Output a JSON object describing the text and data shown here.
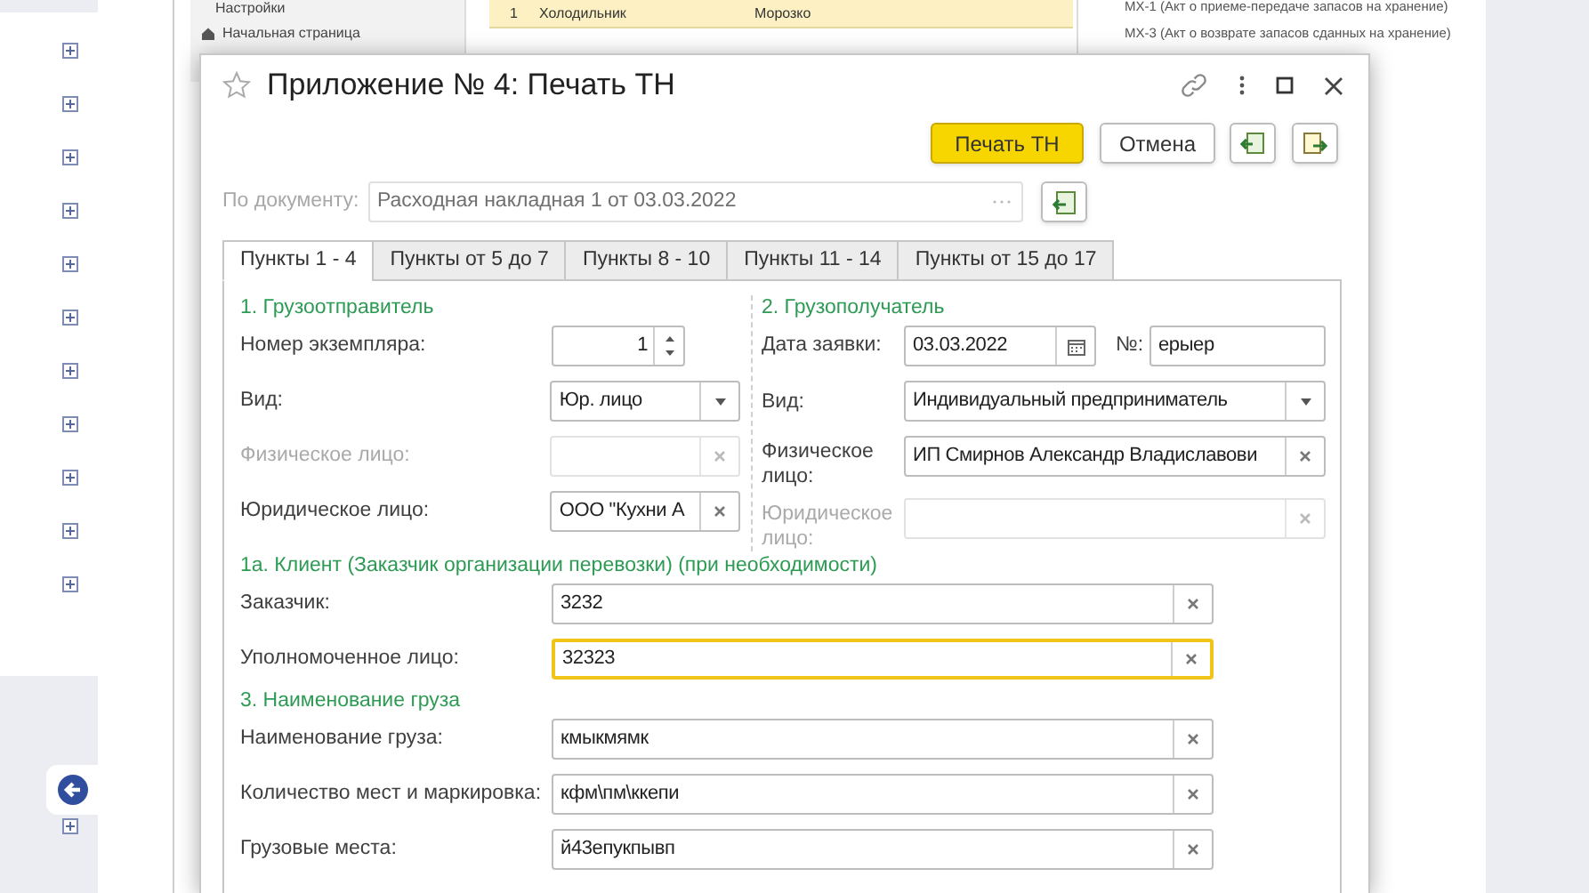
{
  "background": {
    "nav_items": [
      "Настройки",
      "Начальная страница"
    ],
    "table_row": {
      "number": "1",
      "name": "Холодильник",
      "supplier": "Морозко"
    },
    "print_forms": [
      "МХ-1 (Акт о приеме-передаче запасов на хранение)",
      "МХ-3 (Акт о возврате запасов сданных на хранение)"
    ]
  },
  "dialog": {
    "title": "Приложение № 4: Печать ТН",
    "buttons": [
      {
        "label": "Печать ТН",
        "kind": "default"
      },
      {
        "label": "Отмена",
        "kind": "normal"
      }
    ],
    "document": {
      "label": "По документу:",
      "value": "Расходная накладная 1 от 03.03.2022",
      "disabled": true
    },
    "tabs": [
      {
        "label": "Пункты 1 - 4",
        "selected": true
      },
      {
        "label": "Пункты от 5 до 7",
        "selected": false
      },
      {
        "label": "Пункты 8 - 10",
        "selected": false
      },
      {
        "label": "Пункты 11 - 14",
        "selected": false
      },
      {
        "label": "Пункты от 15 до 17",
        "selected": false
      }
    ],
    "shipper": {
      "heading": "1. Грузоотправитель",
      "fields": [
        {
          "label": "Номер экземпляра:",
          "value": "1",
          "kind": "spin",
          "disabled": false
        },
        {
          "label": "Вид:",
          "value": "Юр. лицо",
          "kind": "select",
          "disabled": false
        },
        {
          "label": "Физическое лицо:",
          "kind": "clear",
          "disabled": true
        },
        {
          "label": "Юридическое лицо:",
          "value": "ООО \"Кухни А",
          "kind": "clear",
          "disabled": false
        }
      ]
    },
    "consignee": {
      "heading": "2. Грузополучатель",
      "request_date": {
        "label": "Дата заявки:",
        "value": "03.03.2022"
      },
      "number": {
        "label": "№:",
        "value": "ерыер"
      },
      "fields": [
        {
          "label": "Вид:",
          "value": "Индивидуальный предприниматель",
          "kind": "select",
          "disabled": false
        },
        {
          "label": "Физическое лицо:",
          "value": "ИП Смирнов Александр Владиславови",
          "kind": "clear",
          "disabled": false
        },
        {
          "label": "Юридическое лицо:",
          "kind": "clear",
          "disabled": true
        }
      ]
    },
    "sections": [
      {
        "heading": "1а. Клиент (Заказчик организации перевозки) (при необходимости)",
        "fields": [
          {
            "label": "Заказчик:",
            "value": "3232",
            "focused": false
          },
          {
            "label": "Уполномоченное лицо:",
            "value": "32323",
            "focused": true
          }
        ]
      },
      {
        "heading": "3. Наименование груза",
        "fields": [
          {
            "label": "Наименование груза:",
            "value": "кмыкмямк",
            "focused": false
          },
          {
            "label": "Количество мест и маркировка:",
            "value": "кфм\\пм\\ккепи",
            "focused": false
          },
          {
            "label": "Грузовые места:",
            "value": "й43епукпывп",
            "focused": false
          }
        ]
      }
    ]
  }
}
